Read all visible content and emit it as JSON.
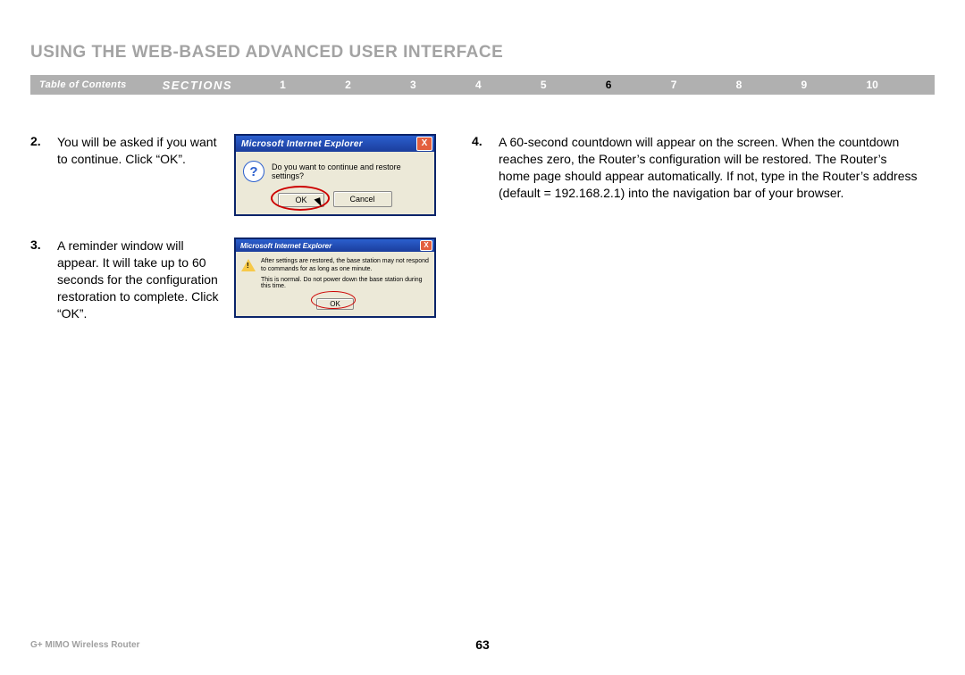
{
  "title": "USING THE WEB-BASED ADVANCED USER INTERFACE",
  "nav": {
    "toc": "Table of Contents",
    "sections_label": "SECTIONS",
    "items": [
      "1",
      "2",
      "3",
      "4",
      "5",
      "6",
      "7",
      "8",
      "9",
      "10"
    ],
    "active": "6"
  },
  "steps": {
    "s2": {
      "num": "2.",
      "text": "You will be asked if you want to continue. Click “OK”."
    },
    "s3": {
      "num": "3.",
      "text": "A reminder window will appear. It will take up to 60 seconds for the configuration restoration to complete. Click “OK”."
    },
    "s4": {
      "num": "4.",
      "text": "A 60-second countdown will appear on the screen. When the countdown reaches zero, the Router’s configuration will be restored. The Router’s home page should appear automatically. If not, type in the Router’s address (default = 192.168.2.1) into the navigation bar of your browser."
    }
  },
  "dialog1": {
    "title": "Microsoft Internet Explorer",
    "message": "Do you want to continue and restore settings?",
    "ok": "OK",
    "cancel": "Cancel",
    "close": "X"
  },
  "dialog2": {
    "title": "Microsoft Internet Explorer",
    "line1": "After settings are restored, the base station may not respond to commands for as long as one minute.",
    "line2": "This is normal. Do not power down the base station during this time.",
    "ok": "OK",
    "close": "X"
  },
  "footer": {
    "product": "G+ MIMO Wireless Router",
    "page": "63"
  }
}
